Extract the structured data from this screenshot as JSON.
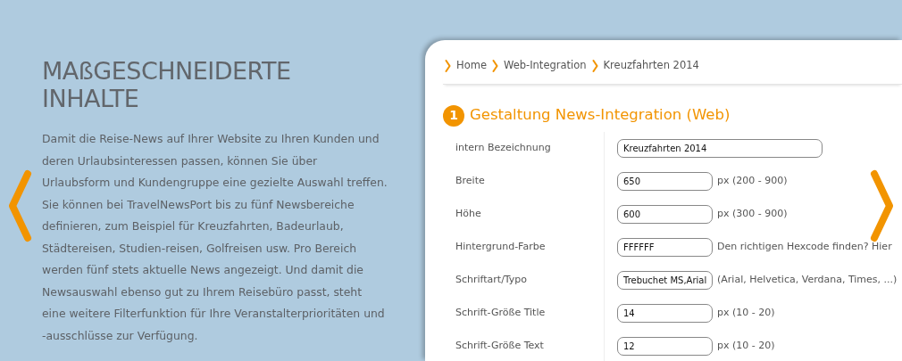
{
  "intro": {
    "heading": "MAßGESCHNEIDERTE INHALTE",
    "text": "Damit die Reise-News auf Ihrer Website zu Ihren Kunden und deren Urlaubsinteressen passen, können Sie über Urlaubsform und Kundengruppe eine gezielte Auswahl treffen. Sie können bei TravelNewsPort bis zu fünf Newsbereiche definieren, zum Beispiel für Kreuzfahrten, Badeurlaub, Städtereisen, Studien-reisen, Golfreisen usw. Pro Bereich werden fünf stets aktuelle News angezeigt. Und damit die Newsauswahl ebenso gut zu Ihrem Reisebüro passt, steht eine weitere Filterfunktion für Ihre Veranstalterprioritäten und -ausschlüsse zur Verfügung."
  },
  "breadcrumb": [
    "Home",
    "Web-Integration",
    "Kreuzfahrten 2014"
  ],
  "section": {
    "number": "1",
    "title": "Gestaltung News-Integration (Web)"
  },
  "fields": [
    {
      "label": "intern Bezeichnung",
      "value": "Kreuzfahrten 2014",
      "kind": "wide"
    },
    {
      "label": "Breite",
      "value": "650",
      "kind": "short",
      "hint": "px (200 - 900)"
    },
    {
      "label": "Höhe",
      "value": "600",
      "kind": "short",
      "hint": "px (300 - 900)"
    },
    {
      "label": "Hintergrund-Farbe",
      "value": "FFFFFF",
      "kind": "short",
      "hint": "Den richtigen Hexcode finden? Hier"
    },
    {
      "label": "Schriftart/Typo",
      "value": "Trebuchet MS,Arial",
      "kind": "short",
      "hint": "(Arial, Helvetica, Verdana, Times, ...)"
    },
    {
      "label": "Schrift-Größe Title",
      "value": "14",
      "kind": "short",
      "hint": "px (10 - 20)"
    },
    {
      "label": "Schrift-Größe Text",
      "value": "12",
      "kind": "short",
      "hint": "px (10 - 20)"
    }
  ]
}
